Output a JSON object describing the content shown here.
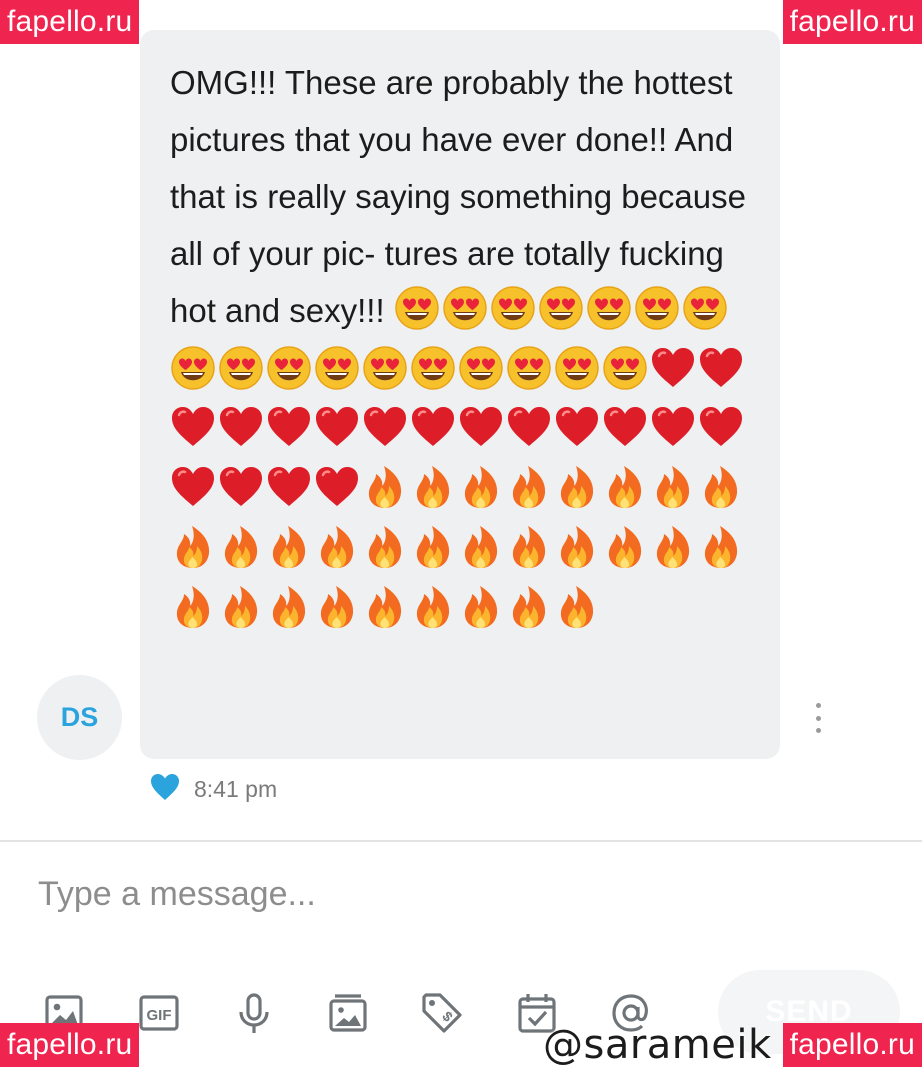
{
  "watermark": "fapello.ru",
  "message": {
    "sender_initials": "DS",
    "text": "OMG!!! These are probably the hottest pictures that you have ever done!! And that is really saying something because all of your pic- tures are totally fucking hot and sexy!!!",
    "emojis": [
      {
        "type": "heart-eyes",
        "count": 17
      },
      {
        "type": "red-heart",
        "count": 18
      },
      {
        "type": "fire",
        "count": 29
      }
    ],
    "time": "8:41 pm",
    "liked": true
  },
  "composer": {
    "placeholder": "Type a message..."
  },
  "toolbar": {
    "icons": [
      "image-icon",
      "gif-icon",
      "microphone-icon",
      "gallery-icon",
      "tag-price-icon",
      "calendar-icon",
      "at-sign-icon"
    ],
    "send_label": "SEND"
  },
  "handle_overlay": "@sarameik",
  "colors": {
    "accent": "#2ba3dd",
    "watermark_bg": "#f0254f",
    "bubble_bg": "#eef0f1"
  }
}
